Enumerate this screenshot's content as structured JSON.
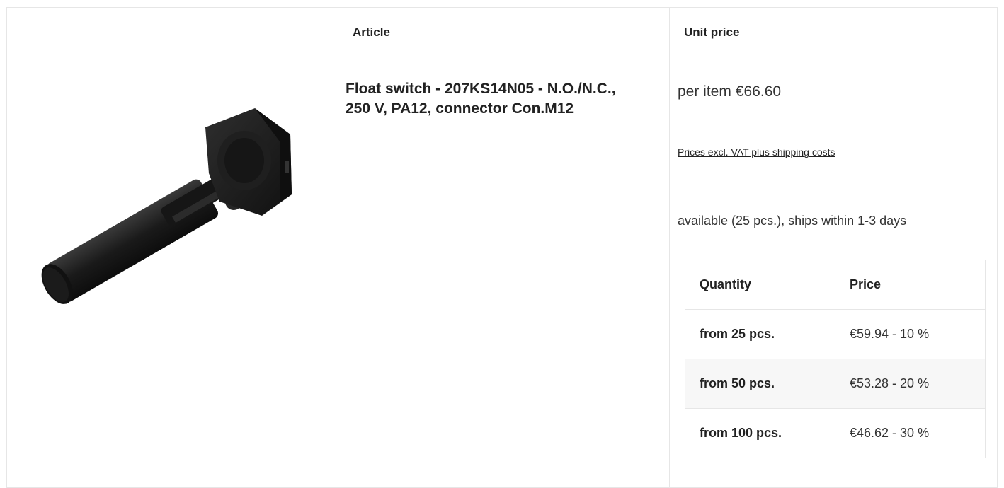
{
  "table": {
    "headers": {
      "image": "",
      "article": "Article",
      "unit_price": "Unit price"
    }
  },
  "product": {
    "title": "Float switch - 207KS14N05 - N.O./N.C., 250 V, PA12, connector Con.M12",
    "image_alt": "Float switch 207KS14N05",
    "price_label": "per item",
    "price_value": "€66.60",
    "vat_link": "Prices excl. VAT plus shipping costs",
    "availability": "available (25 pcs.), ships within 1-3 days"
  },
  "tier_prices": {
    "headers": {
      "quantity": "Quantity",
      "price": "Price"
    },
    "rows": [
      {
        "quantity": "from 25 pcs.",
        "price": "€59.94 - 10 %"
      },
      {
        "quantity": "from 50 pcs.",
        "price": "€53.28 - 20 %"
      },
      {
        "quantity": "from 100 pcs.",
        "price": "€46.62 - 30 %"
      }
    ]
  },
  "colors": {
    "border": "#e6e6e6",
    "text": "#222222",
    "product_body": "#1c1c1c",
    "stripe": "#f7f7f7"
  }
}
